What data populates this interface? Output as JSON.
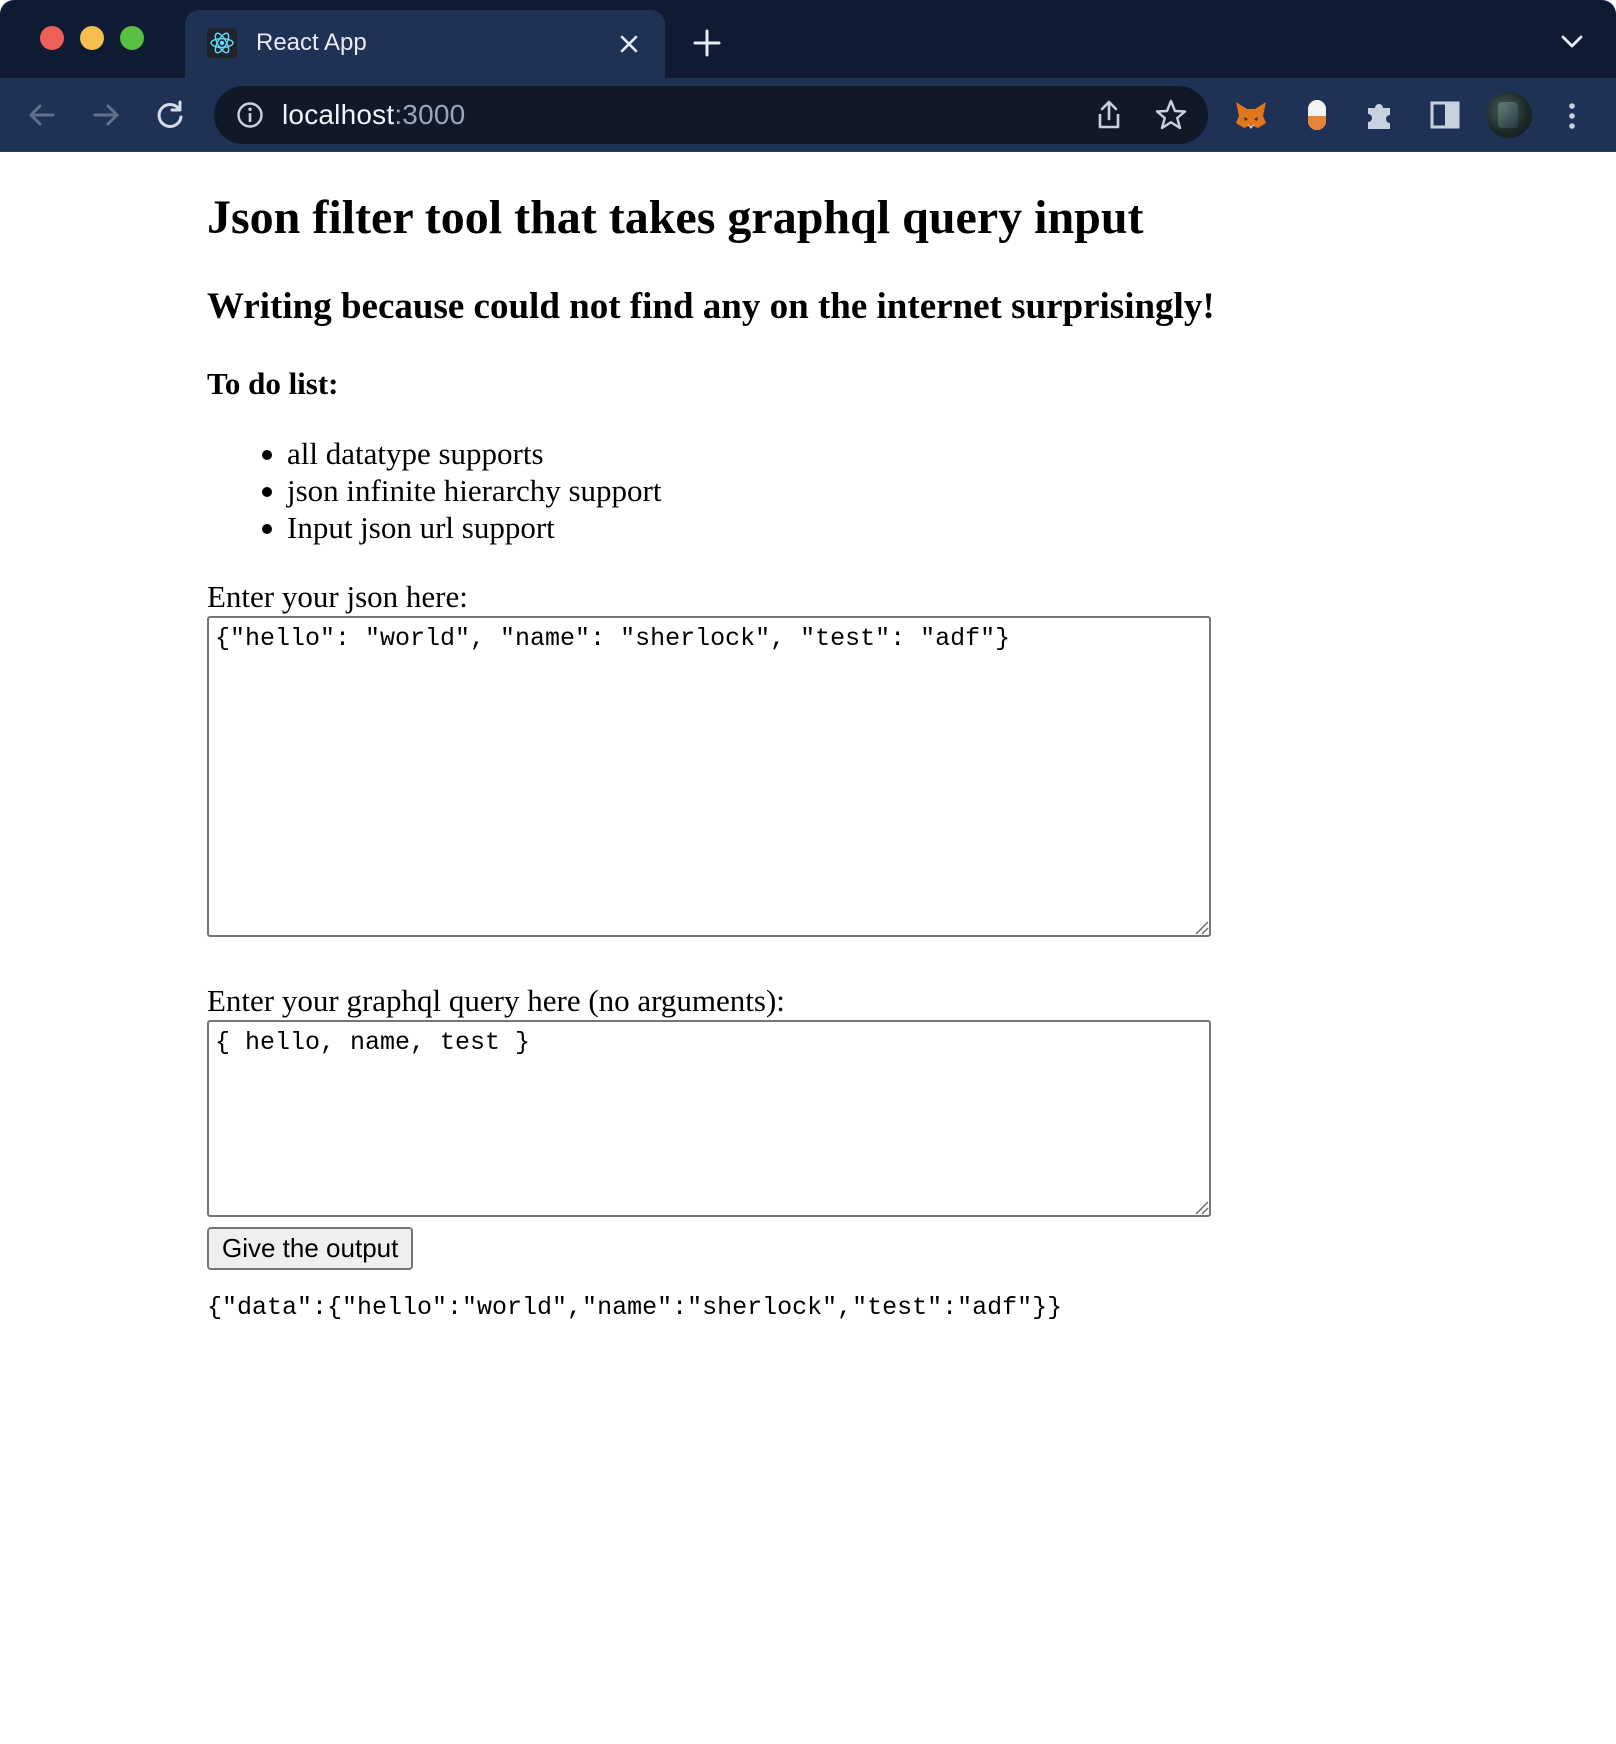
{
  "browser": {
    "tab_title": "React App",
    "url_host": "localhost",
    "url_port": ":3000",
    "colors": {
      "tabstrip": "#0f1a33",
      "toolbar": "#1f3256",
      "omnibox": "#111827"
    },
    "icons": [
      "react-icon",
      "close-icon",
      "plus-icon",
      "chevron-down-icon",
      "back-arrow-icon",
      "forward-arrow-icon",
      "reload-icon",
      "info-icon",
      "share-icon",
      "star-icon",
      "fox-extension-icon",
      "pill-extension-icon",
      "puzzle-icon",
      "side-panel-icon",
      "avatar",
      "kebab-menu-icon"
    ]
  },
  "page": {
    "title": "Json filter tool that takes graphql query input",
    "subtitle": "Writing because could not find any on the internet surprisingly!",
    "todo_heading": "To do list:",
    "todo_items": [
      "all datatype supports",
      "json infinite hierarchy support",
      "Input json url support"
    ],
    "json_label": "Enter your json here:",
    "json_value": "{\"hello\": \"world\", \"name\": \"sherlock\", \"test\": \"adf\"}",
    "query_label": "Enter your graphql query here (no arguments):",
    "query_value": "{ hello, name, test }",
    "button_label": "Give the output",
    "output": "{\"data\":{\"hello\":\"world\",\"name\":\"sherlock\",\"test\":\"adf\"}}"
  }
}
